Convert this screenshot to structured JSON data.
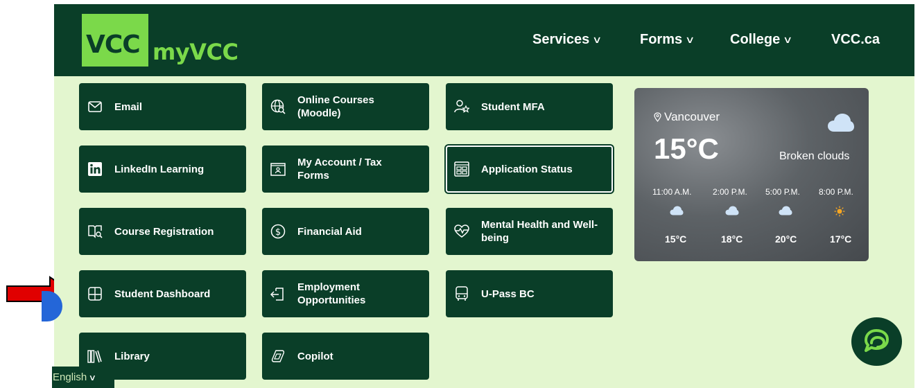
{
  "brand": {
    "logo_mark": "VCC",
    "logo_text": "myVCC"
  },
  "nav": [
    {
      "label": "Services",
      "chevron": "∨"
    },
    {
      "label": "Forms",
      "chevron": "∨"
    },
    {
      "label": "College",
      "chevron": "∨"
    },
    {
      "label": "VCC.ca"
    }
  ],
  "tiles": [
    {
      "label": "Email",
      "icon": "mail-icon"
    },
    {
      "label": "Online Courses (Moodle)",
      "icon": "globe-search-icon"
    },
    {
      "label": "Student MFA",
      "icon": "user-star-icon"
    },
    {
      "label": "LinkedIn Learning",
      "icon": "linkedin-icon"
    },
    {
      "label": "My Account / Tax Forms",
      "icon": "account-form-icon"
    },
    {
      "label": "Application Status",
      "icon": "application-grid-icon"
    },
    {
      "label": "Course Registration",
      "icon": "book-search-icon"
    },
    {
      "label": "Financial Aid",
      "icon": "dollar-circle-icon"
    },
    {
      "label": "Mental Health and Well-being",
      "icon": "heartbeat-icon"
    },
    {
      "label": "Student Dashboard",
      "icon": "dashboard-icon"
    },
    {
      "label": "Employment Opportunities",
      "icon": "door-exit-icon"
    },
    {
      "label": "U-Pass BC",
      "icon": "bus-icon"
    },
    {
      "label": "Library",
      "icon": "books-icon"
    },
    {
      "label": "Copilot",
      "icon": "copilot-icon"
    }
  ],
  "weather": {
    "location": "Vancouver",
    "temperature": "15°C",
    "condition": "Broken clouds",
    "hourly": [
      {
        "time": "11:00 A.M.",
        "icon": "cloud-icon",
        "temp": "15°C"
      },
      {
        "time": "2:00 P.M.",
        "icon": "cloud-icon",
        "temp": "18°C"
      },
      {
        "time": "5:00 P.M.",
        "icon": "cloud-icon",
        "temp": "20°C"
      },
      {
        "time": "8:00 P.M.",
        "icon": "sun-icon",
        "temp": "17°C"
      }
    ]
  },
  "language": {
    "label": "English",
    "chevron": "∨"
  },
  "colors": {
    "brand_dark": "#0a3e28",
    "brand_green": "#7bd94a",
    "page_bg": "#e3f6cf",
    "annotation_arrow": "#e00000"
  }
}
